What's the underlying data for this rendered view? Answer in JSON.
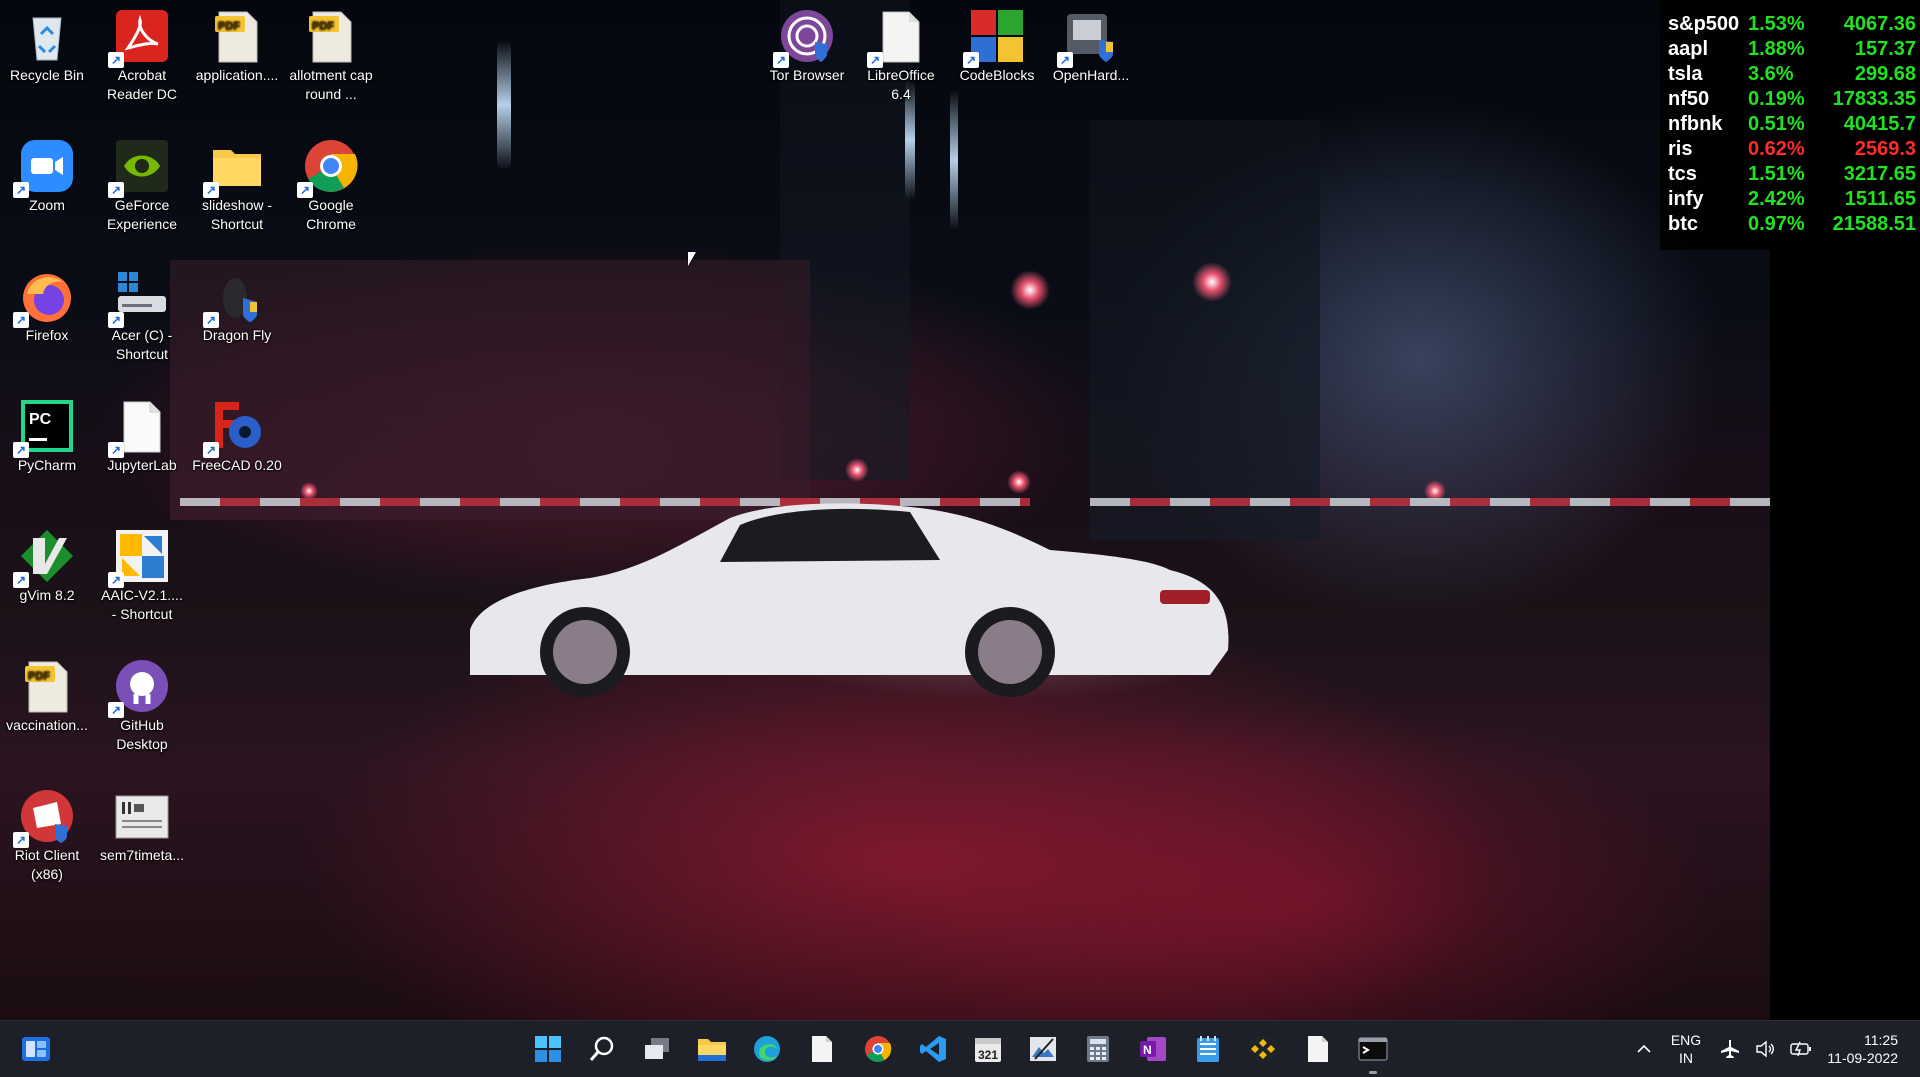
{
  "desktop": {
    "icons": [
      {
        "label": "Recycle Bin",
        "icon": "recycle-bin-icon"
      },
      {
        "label": "Acrobat Reader DC",
        "icon": "acrobat-reader-icon"
      },
      {
        "label": "application....",
        "icon": "pdf-file-icon"
      },
      {
        "label": "allotment cap round ...",
        "icon": "pdf-file-icon"
      },
      {
        "label": "Zoom",
        "icon": "zoom-icon"
      },
      {
        "label": "GeForce Experience",
        "icon": "geforce-experience-icon"
      },
      {
        "label": "slideshow - Shortcut",
        "icon": "folder-icon"
      },
      {
        "label": "Google Chrome",
        "icon": "chrome-icon"
      },
      {
        "label": "Firefox",
        "icon": "firefox-icon"
      },
      {
        "label": "Acer (C) - Shortcut",
        "icon": "drive-icon"
      },
      {
        "label": "Dragon Fly",
        "icon": "mouse-app-icon"
      },
      {
        "label": "PyCharm",
        "icon": "pycharm-icon"
      },
      {
        "label": "JupyterLab",
        "icon": "blank-file-icon"
      },
      {
        "label": "FreeCAD 0.20",
        "icon": "freecad-icon"
      },
      {
        "label": "gVim 8.2",
        "icon": "gvim-icon"
      },
      {
        "label": "AAIC-V2.1.... - Shortcut",
        "icon": "aaic-icon"
      },
      {
        "label": "vaccination...",
        "icon": "pdf-file-icon"
      },
      {
        "label": "GitHub Desktop",
        "icon": "github-desktop-icon"
      },
      {
        "label": "Riot Client (x86)",
        "icon": "riot-client-icon"
      },
      {
        "label": "sem7timeta...",
        "icon": "image-file-icon"
      },
      {
        "label": "Tor Browser",
        "icon": "tor-browser-icon"
      },
      {
        "label": "LibreOffice 6.4",
        "icon": "libreoffice-icon"
      },
      {
        "label": "CodeBlocks",
        "icon": "codeblocks-icon"
      },
      {
        "label": "OpenHard...",
        "icon": "openhardware-icon"
      }
    ]
  },
  "ticker": {
    "rows": [
      {
        "symbol": "s&p500",
        "change": "1.53%",
        "value": "4067.36",
        "trend": "up"
      },
      {
        "symbol": "aapl",
        "change": "1.88%",
        "value": "157.37",
        "trend": "up"
      },
      {
        "symbol": "tsla",
        "change": "3.6%",
        "value": "299.68",
        "trend": "up"
      },
      {
        "symbol": "nf50",
        "change": "0.19%",
        "value": "17833.35",
        "trend": "up"
      },
      {
        "symbol": "nfbnk",
        "change": "0.51%",
        "value": "40415.7",
        "trend": "up"
      },
      {
        "symbol": "ris",
        "change": "0.62%",
        "value": "2569.3",
        "trend": "down"
      },
      {
        "symbol": "tcs",
        "change": "1.51%",
        "value": "3217.65",
        "trend": "up"
      },
      {
        "symbol": "infy",
        "change": "2.42%",
        "value": "1511.65",
        "trend": "up"
      },
      {
        "symbol": "btc",
        "change": "0.97%",
        "value": "21588.51",
        "trend": "up"
      }
    ]
  },
  "taskbar": {
    "apps": [
      "start-icon",
      "search-icon",
      "task-view-icon",
      "file-explorer-icon",
      "edge-icon",
      "blank-file-icon",
      "chrome-icon",
      "vscode-icon",
      "calendar-app-icon",
      "image-editor-icon",
      "calculator-icon",
      "onenote-icon",
      "notepad-icon",
      "binance-icon",
      "blank-file-icon",
      "terminal-icon"
    ],
    "tray": {
      "language": "ENG",
      "region": "IN",
      "time": "11:25",
      "date": "11-09-2022"
    },
    "colors": {
      "background": "#1d2029",
      "accent": "#3b8cf0"
    }
  },
  "colors": {
    "ticker_up": "#22e022",
    "ticker_down": "#ff2a2a"
  }
}
